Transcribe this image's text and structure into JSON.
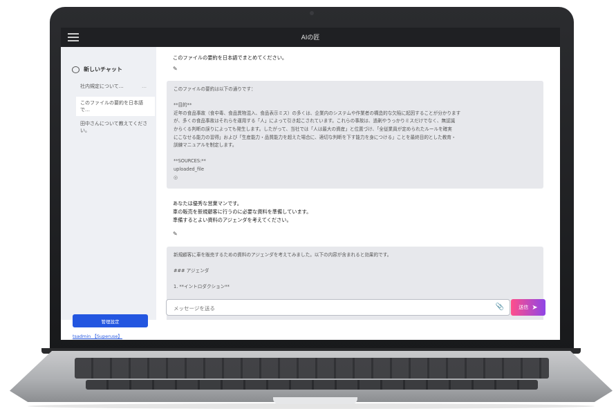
{
  "app": {
    "title": "AIの匠"
  },
  "sidebar": {
    "new_chat_label": "新しいチャット",
    "items": [
      {
        "label": "社内規定について…",
        "more": "…"
      },
      {
        "label": "このファイルの要約を日本語で…"
      },
      {
        "label": "田中さんについて教えてください。"
      }
    ],
    "admin_button": "管理設定",
    "user_link": "tsadmin 【Superuse】"
  },
  "chat": {
    "messages": [
      {
        "role": "user",
        "text": "このファイルの要約を日本語でまとめてください。"
      },
      {
        "role": "assistant",
        "text": "このファイルの要約は以下の通りです：\n\n**目的**\n近年の食品事故（食中毒、食品異物混入、食品表示ミス）の多くは、企業内のシステムや作業者の構造的な欠陥に起因することが分かります\nが、多くの食品事故はそれらを運用する「人」によって引き起こされています。これらの事故は、過剰やうっかりミスだけでなく、無認識\nからくる判断の誤りによっても発生します。したがって、当社では「人は最大の資産」と位置づけ、「全従業員が定められたルールを確実\nにこなせる能力の習得」および「生産能力・品質能力を超えた場合に、適切な判断を下す能力を身につける」ことを最終目的とした教育・\n訓練マニュアルを制定します。\n\n**SOURCES:**\nuploaded_file",
        "icon": "◎"
      },
      {
        "role": "user",
        "text": "あなたは優秀な営業マンです。\n車の販売を新規顧客に行うのに必要な資料を準備しています。\n準備するとよい資料のアジェンダを考えてください。"
      },
      {
        "role": "assistant",
        "text": "新規顧客に車を販売するための資料のアジェンダを考えてみました。以下の内容が含まれると効果的です。\n\n### アジェンダ\n\n1. **イントロダクション**"
      }
    ],
    "edit_icon": "pencil-icon"
  },
  "composer": {
    "placeholder": "メッセージを送る",
    "send_label": "送信"
  }
}
